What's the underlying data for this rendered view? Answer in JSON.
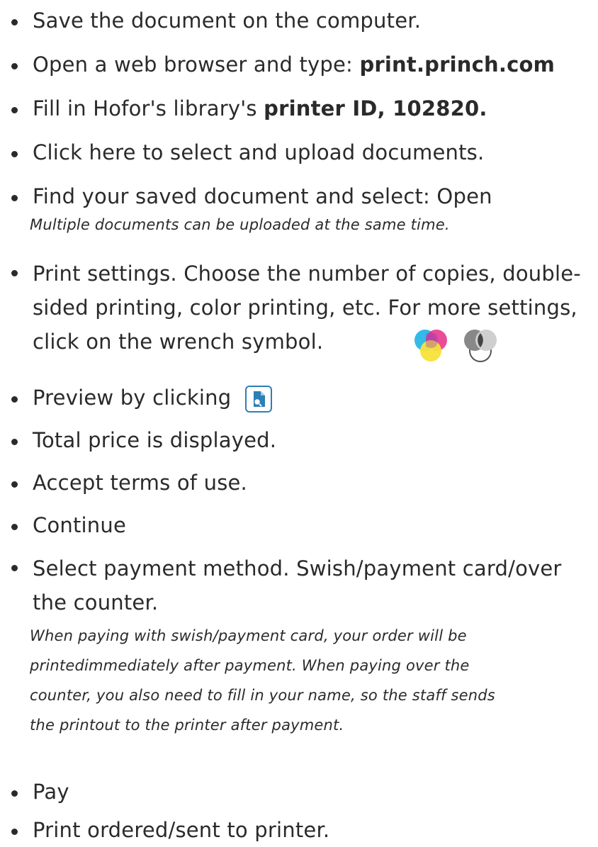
{
  "steps": [
    {
      "text": "Save the document on the computer."
    },
    {
      "text": "Open a web browser and type: ",
      "bold": "print.princh.com"
    },
    {
      "text": "Fill in Hofor's library's ",
      "bold": "printer ID, 102820."
    },
    {
      "text": "Click here to select and upload documents."
    },
    {
      "text": "Find your saved document and select: Open",
      "note": "Multiple documents can be uploaded at the same time."
    },
    {
      "text_line1": "Print settings. Choose the number of copies, double-",
      "text_line2": "sided printing, color printing, etc. For more settings,",
      "text_line3": "click on the wrench symbol.",
      "icons": [
        "color-print-icon",
        "black-white-print-icon"
      ]
    },
    {
      "text": "Preview by clicking",
      "icon": "preview-icon"
    },
    {
      "text": "Total price is displayed."
    },
    {
      "text": "Accept terms of use."
    },
    {
      "text": "Continue"
    },
    {
      "text_line1": "Select payment method. Swish/payment card/over",
      "text_line2": "the counter.",
      "note_line1": "When paying with swish/payment card, your order will be",
      "note_line2": "printedimmediately after payment. When paying over the",
      "note_line3": "counter, you also need to fill in your name, so the staff sends",
      "note_line4": "the printout to the printer after payment."
    },
    {
      "text": "Pay"
    },
    {
      "text": "Print ordered/sent to printer."
    }
  ],
  "colors": {
    "text": "#2a2a2a",
    "preview_icon": "#2c7fb8",
    "cyan": "#29b6e8",
    "magenta": "#e8388f",
    "yellow": "#f7e33a"
  }
}
